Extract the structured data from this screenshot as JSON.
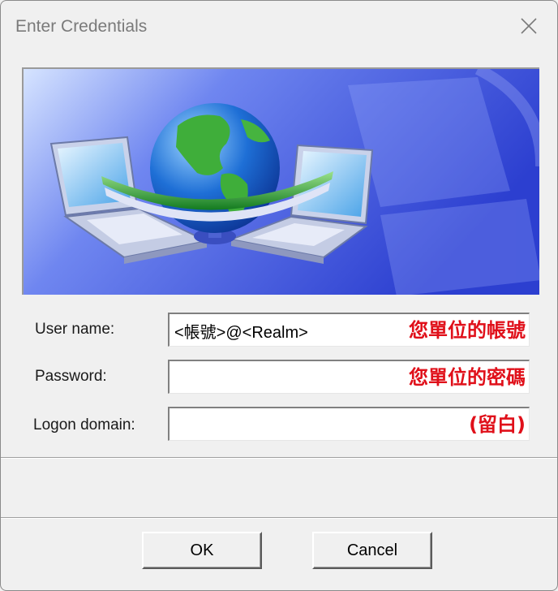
{
  "window": {
    "title": "Enter Credentials",
    "close_icon": "close-icon"
  },
  "banner": {
    "image": "network-globe-laptops-illustration",
    "colors": {
      "sky": "#3a50d8",
      "globe_ocean": "#1e6fd6",
      "globe_land": "#3fae3a",
      "band": "#1f9e2e"
    }
  },
  "form": {
    "user_name": {
      "label": "User name:",
      "value": "<帳號>@<Realm>",
      "hint": "您單位的帳號"
    },
    "password": {
      "label": "Password:",
      "value": "",
      "hint": "您單位的密碼"
    },
    "logon_domain": {
      "label": "Logon domain:",
      "value": "",
      "hint": "(留白)"
    },
    "hint_color": "#e0101a"
  },
  "buttons": {
    "ok": "OK",
    "cancel": "Cancel"
  }
}
